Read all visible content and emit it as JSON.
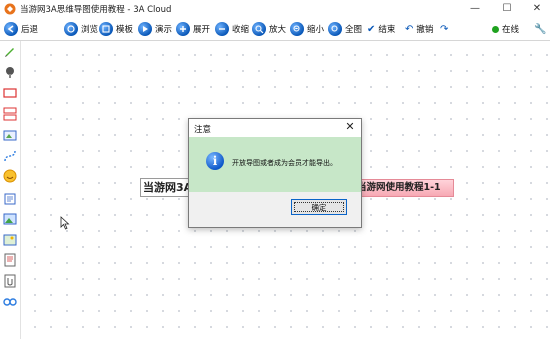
{
  "window": {
    "title": "当游网3A思维导图使用教程 - 3A Cloud",
    "min": "—",
    "max": "☐",
    "close": "✕"
  },
  "toolbar": {
    "back": "后退",
    "browse": "浏览",
    "template": "模板",
    "present": "演示",
    "expand": "展开",
    "collapse": "收缩",
    "zoom_in": "放大",
    "zoom_out": "缩小",
    "full": "全图",
    "finish": "结束",
    "undo": "撤销",
    "online": "在线"
  },
  "canvas": {
    "main_node": "当游网3A思维导图使用教程",
    "sub_node": "当游网使用教程1-1"
  },
  "dialog": {
    "title": "注意",
    "message": "开放导图或者成为会员才能导出。",
    "ok": "确定"
  },
  "colors": {
    "dialog_body": "#c7e7c8",
    "sub_node": "#f7a9b4",
    "accent": "#0a58b8"
  }
}
